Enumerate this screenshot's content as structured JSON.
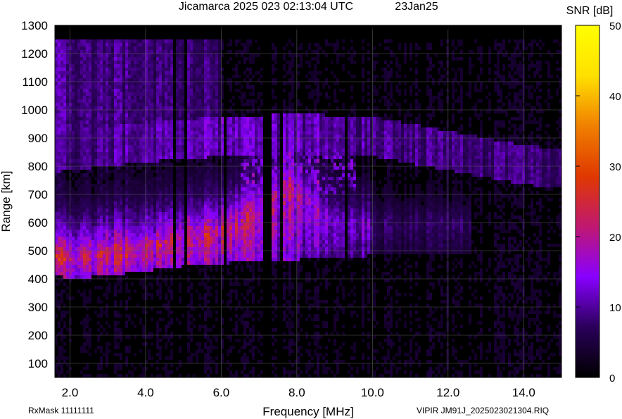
{
  "header": {
    "title": "Jicamarca 2025 023 02:13:04 UTC",
    "date": "23Jan25"
  },
  "footer": {
    "rx_mask": "RxMask 11111111",
    "file_info": "VIPIR  JM91J_2025023021304.RIQ"
  },
  "colorbar": {
    "label": "SNR [dB]",
    "range": [
      0,
      50
    ],
    "ticks": [
      0,
      10,
      20,
      30,
      40,
      50
    ],
    "colormap_stops": [
      "#000000",
      "#2a005a",
      "#8800ff",
      "#c01870",
      "#e03800",
      "#f08000",
      "#ffe000",
      "#ffff00"
    ]
  },
  "chart_data": {
    "type": "heatmap",
    "title": "Jicamarca 2025 023 02:13:04 UTC",
    "xlabel": "Frequency [MHz]",
    "ylabel": "Range [km]",
    "xlim": [
      1.6,
      15.0
    ],
    "ylim": [
      50,
      1300
    ],
    "data_range_max": 1245,
    "xticks": [
      2.0,
      4.0,
      6.0,
      8.0,
      10.0,
      12.0,
      14.0
    ],
    "xtick_labels": [
      "2.0",
      "4.0",
      "6.0",
      "8.0",
      "10.0",
      "12.0",
      "14.0"
    ],
    "yticks": [
      100,
      200,
      300,
      400,
      500,
      600,
      700,
      800,
      900,
      1000,
      1100,
      1200,
      1300
    ],
    "grid": true,
    "value_label": "SNR [dB]",
    "traces": [
      {
        "layer": "O-trace lower edge",
        "x": [
          1.7,
          2.0,
          3.0,
          4.0,
          5.0,
          6.0,
          7.0,
          8.0,
          9.0,
          10.0,
          11.0,
          12.0
        ],
        "y": [
          410,
          402,
          410,
          428,
          445,
          455,
          460,
          468,
          475,
          482,
          488,
          492
        ]
      },
      {
        "layer": "O-trace peak",
        "x": [
          2.0,
          4.0,
          6.0,
          7.0,
          7.8,
          9.0
        ],
        "y": [
          480,
          510,
          570,
          640,
          740,
          600
        ],
        "snr": [
          32,
          30,
          28,
          26,
          25,
          18
        ]
      },
      {
        "layer": "echo upper band",
        "x": [
          1.7,
          4.0,
          6.0,
          8.0,
          10.0,
          12.0,
          14.0,
          15.0
        ],
        "y": [
          850,
          885,
          905,
          915,
          905,
          855,
          805,
          790
        ],
        "snr": [
          12,
          14,
          15,
          15,
          13,
          12,
          11,
          10
        ]
      },
      {
        "layer": "multiple hop",
        "x": [
          1.8,
          3.0,
          4.5,
          5.5
        ],
        "y": [
          990,
          1010,
          1030,
          1050
        ],
        "snr": [
          14,
          13,
          12,
          11
        ]
      }
    ],
    "notes_visible": []
  }
}
